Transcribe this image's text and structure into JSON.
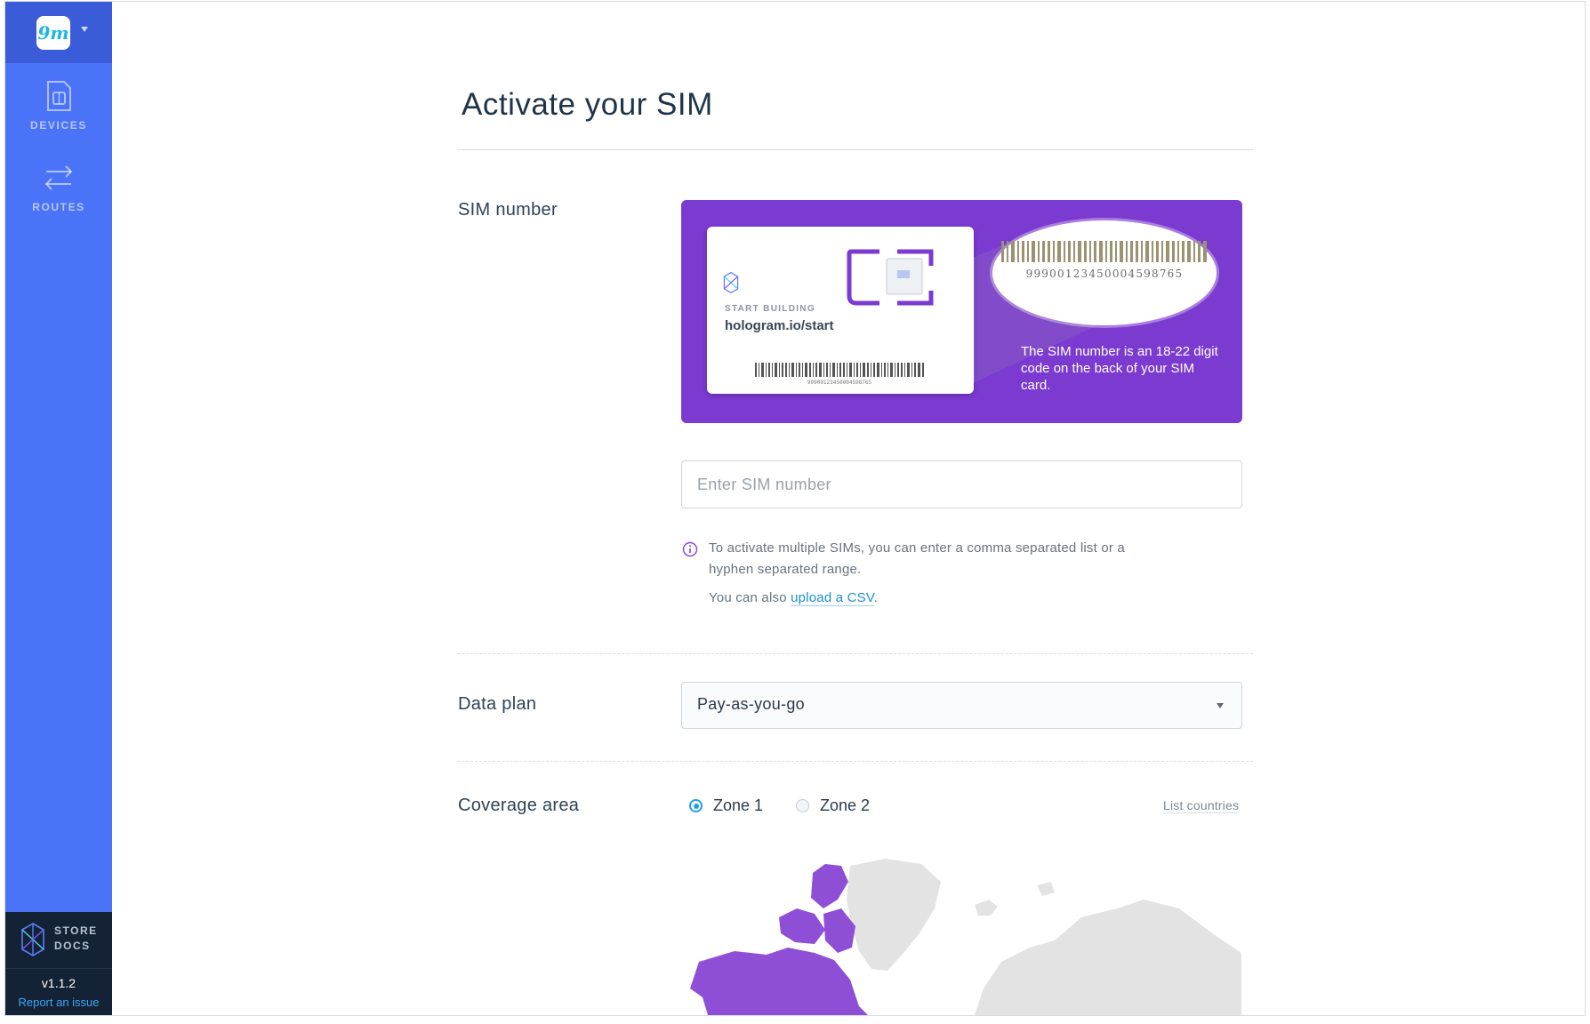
{
  "sidebar": {
    "logo_text": "9m",
    "nav": [
      {
        "label": "DEVICES",
        "icon": "sim-card-icon"
      },
      {
        "label": "ROUTES",
        "icon": "routes-arrows-icon"
      }
    ],
    "links": [
      {
        "label": "STORE"
      },
      {
        "label": "DOCS"
      }
    ],
    "version": "v1.1.2",
    "report_issue": "Report an issue"
  },
  "page": {
    "title": "Activate your SIM"
  },
  "sim_number": {
    "label": "SIM number",
    "illustration": {
      "card_small_text": "START BUILDING",
      "card_url": "hologram.io/start",
      "card_number": "99900123450004598765",
      "oval_number": "99900123450004598765",
      "caption": "The SIM number is an 18-22 digit code on the back of your SIM card."
    },
    "input_placeholder": "Enter SIM number",
    "input_value": "",
    "info_text": "To activate multiple SIMs, you can enter a comma separated list or a hyphen separated range.",
    "csv_prefix": "You can also ",
    "csv_link": "upload a CSV",
    "csv_suffix": "."
  },
  "data_plan": {
    "label": "Data plan",
    "selected": "Pay-as-you-go"
  },
  "coverage": {
    "label": "Coverage area",
    "options": [
      {
        "label": "Zone 1",
        "selected": true
      },
      {
        "label": "Zone 2",
        "selected": false
      }
    ],
    "list_countries": "List countries"
  },
  "colors": {
    "sidebar": "#4a73f8",
    "sidebar_dark": "#142236",
    "banner_purple": "#7b3ad0",
    "map_highlight": "#8e4fd6",
    "map_base": "#e3e3e3",
    "link_blue": "#1b8fd6"
  }
}
